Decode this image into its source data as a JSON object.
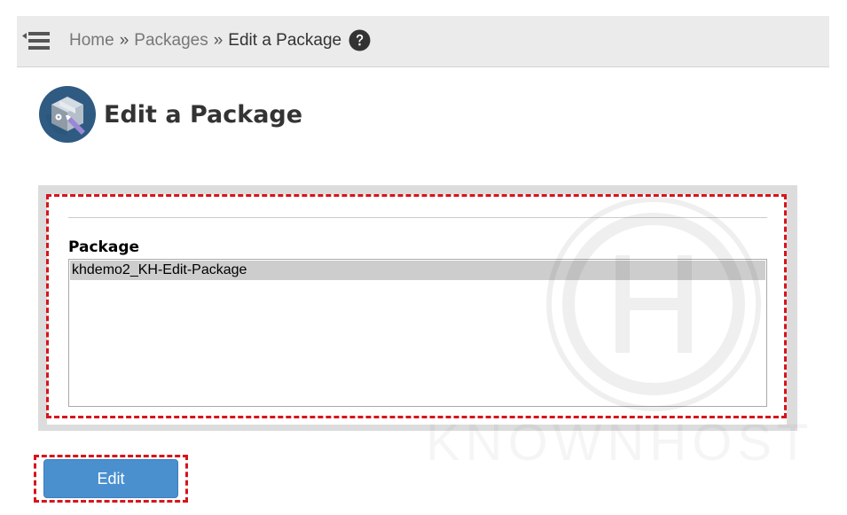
{
  "breadcrumb": {
    "items": [
      "Home",
      "Packages"
    ],
    "separator": "»",
    "current": "Edit a Package"
  },
  "page": {
    "title": "Edit a Package"
  },
  "form": {
    "package_label": "Package",
    "packages": [
      "khdemo2_KH-Edit-Package"
    ],
    "selected_index": 0
  },
  "actions": {
    "edit_label": "Edit"
  },
  "watermark": {
    "text": "KNOWNHOST"
  },
  "colors": {
    "accent": "#4a90cf",
    "highlight_outline": "#d6141c",
    "topbar": "#ebebeb"
  },
  "icons": {
    "menu": "hamburger-back-icon",
    "help": "question-circle-icon",
    "page": "package-box-edit-icon"
  }
}
